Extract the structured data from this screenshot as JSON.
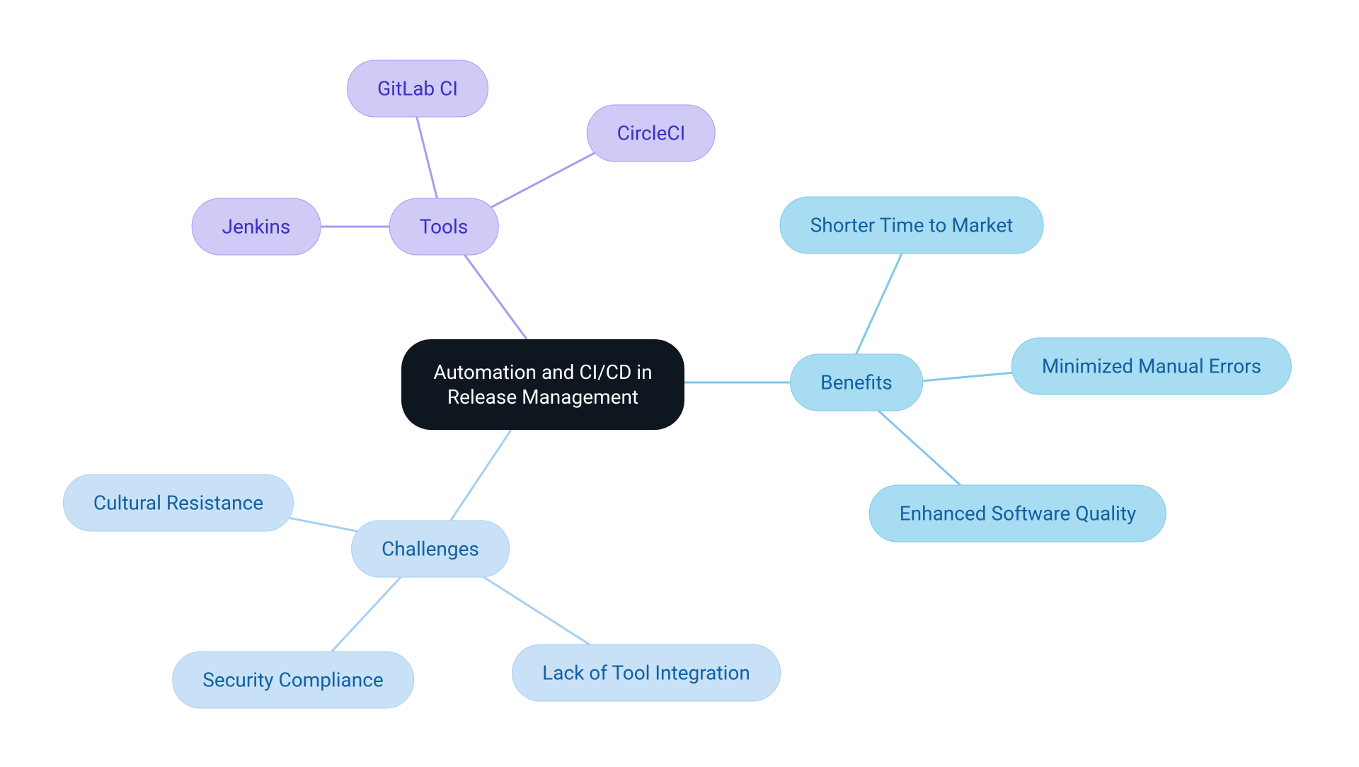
{
  "center": {
    "label": "Automation and CI/CD in Release Management"
  },
  "branches": {
    "tools": {
      "label": "Tools",
      "children": {
        "jenkins": "Jenkins",
        "gitlab": "GitLab CI",
        "circleci": "CircleCI"
      }
    },
    "benefits": {
      "label": "Benefits",
      "children": {
        "shorter_ttm": "Shorter Time to Market",
        "min_errors": "Minimized Manual Errors",
        "quality": "Enhanced Software Quality"
      }
    },
    "challenges": {
      "label": "Challenges",
      "children": {
        "cultural": "Cultural Resistance",
        "security": "Security Compliance",
        "lack_integration": "Lack of Tool Integration"
      }
    }
  },
  "colors": {
    "purple_stroke": "#a79cf0",
    "blue_stroke": "#7fc9e8",
    "lightblue_stroke": "#a9cff0"
  }
}
